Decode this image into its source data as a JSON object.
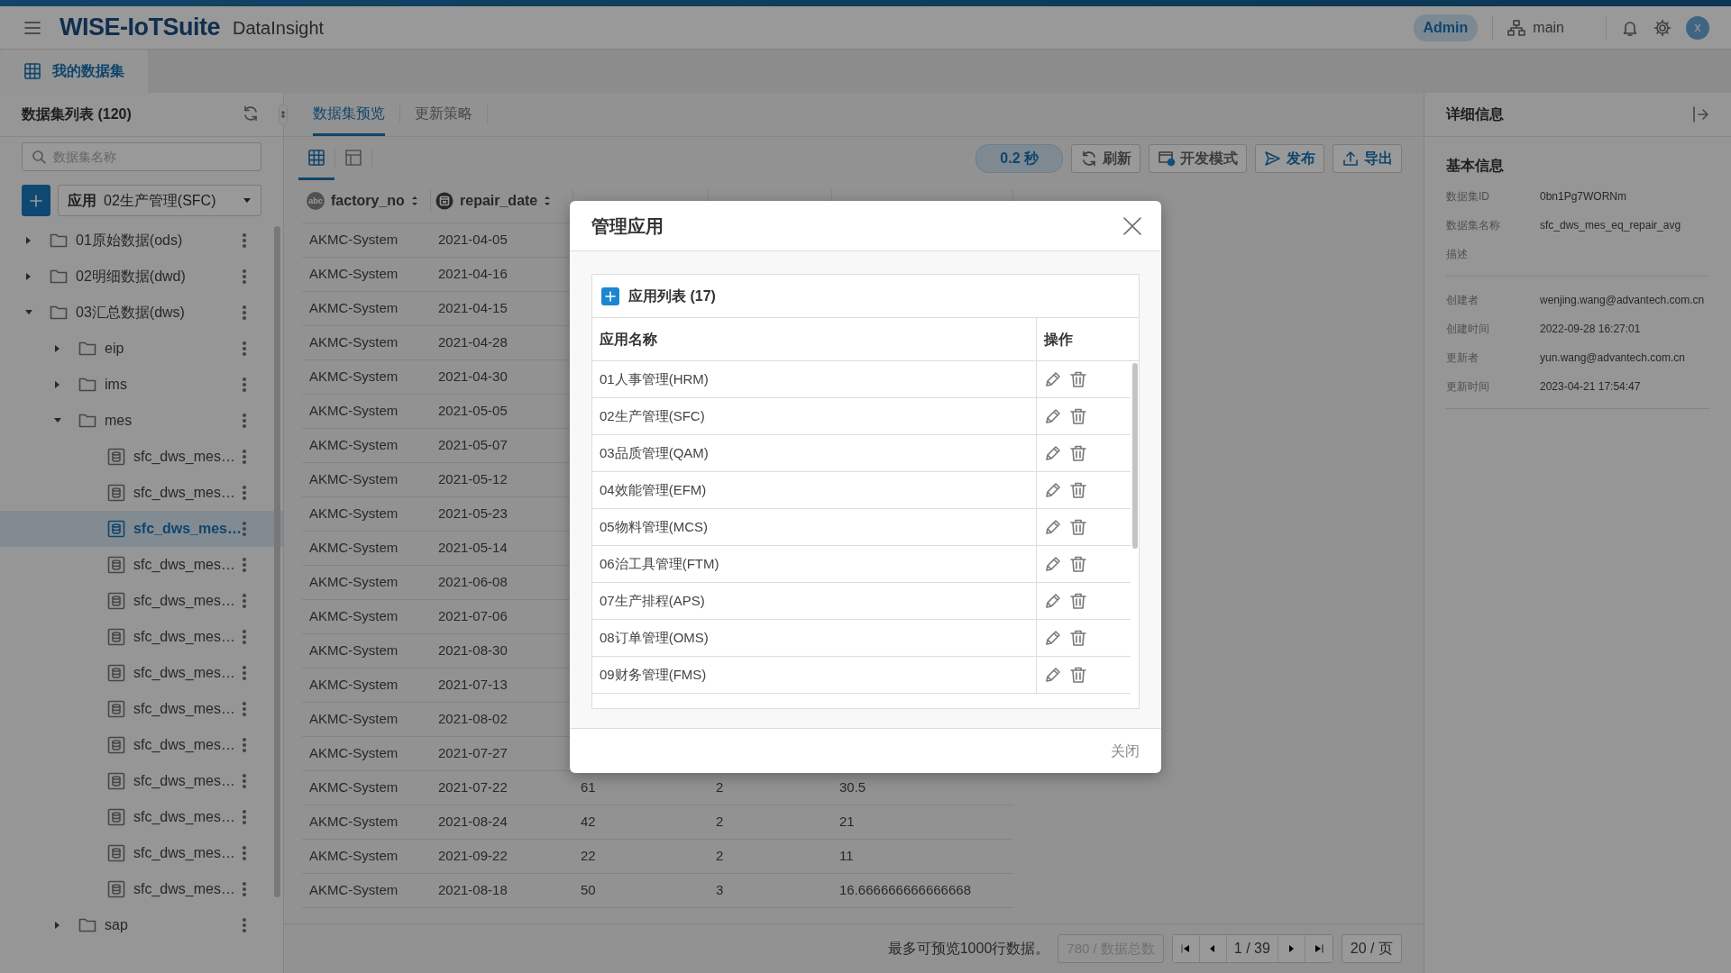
{
  "header": {
    "brand": "WISE-IoTSuite",
    "product": "DataInsight",
    "role": "Admin",
    "workspace": "main",
    "avatar": "x"
  },
  "page_tabs": [
    {
      "label": "我的数据集",
      "selected": true
    }
  ],
  "dataset_list": {
    "title": "数据集列表 (120)",
    "search_placeholder": "数据集名称",
    "app_label": "应用",
    "app_value": "02生产管理(SFC)",
    "tree": [
      {
        "label": "01原始数据(ods)",
        "kind": "folder",
        "expanded": false,
        "selected": false
      },
      {
        "label": "02明细数据(dwd)",
        "kind": "folder",
        "expanded": false,
        "selected": false
      },
      {
        "label": "03汇总数据(dws)",
        "kind": "folder",
        "expanded": true,
        "selected": false,
        "children": [
          {
            "label": "eip",
            "kind": "folder",
            "expanded": false,
            "selected": false
          },
          {
            "label": "ims",
            "kind": "folder",
            "expanded": false,
            "selected": false
          },
          {
            "label": "mes",
            "kind": "folder",
            "expanded": true,
            "selected": false,
            "children": [
              {
                "label": "sfc_dws_mes…",
                "kind": "dataset",
                "selected": false
              },
              {
                "label": "sfc_dws_mes…",
                "kind": "dataset",
                "selected": false
              },
              {
                "label": "sfc_dws_mes…",
                "kind": "dataset",
                "selected": true
              },
              {
                "label": "sfc_dws_mes…",
                "kind": "dataset",
                "selected": false
              },
              {
                "label": "sfc_dws_mes…",
                "kind": "dataset",
                "selected": false
              },
              {
                "label": "sfc_dws_mes…",
                "kind": "dataset",
                "selected": false
              },
              {
                "label": "sfc_dws_mes…",
                "kind": "dataset",
                "selected": false
              },
              {
                "label": "sfc_dws_mes…",
                "kind": "dataset",
                "selected": false
              },
              {
                "label": "sfc_dws_mes…",
                "kind": "dataset",
                "selected": false
              },
              {
                "label": "sfc_dws_mes…",
                "kind": "dataset",
                "selected": false
              },
              {
                "label": "sfc_dws_mes…",
                "kind": "dataset",
                "selected": false
              },
              {
                "label": "sfc_dws_mes…",
                "kind": "dataset",
                "selected": false
              },
              {
                "label": "sfc_dws_mes…",
                "kind": "dataset",
                "selected": false
              }
            ]
          },
          {
            "label": "sap",
            "kind": "folder",
            "expanded": false,
            "selected": false
          }
        ]
      }
    ]
  },
  "preview": {
    "tabs": [
      {
        "label": "数据集预览",
        "selected": true
      },
      {
        "label": "更新策略",
        "selected": false
      }
    ],
    "view_modes": [
      {
        "kind": "grid",
        "selected": true
      },
      {
        "kind": "layout",
        "selected": false
      }
    ],
    "timing": "0.2 秒",
    "actions": [
      {
        "label": "刷新",
        "kind": "refresh",
        "primary": false
      },
      {
        "label": "开发模式",
        "kind": "dev",
        "primary": false
      },
      {
        "label": "发布",
        "kind": "publish",
        "primary": true
      },
      {
        "label": "导出",
        "kind": "export",
        "primary": true
      }
    ],
    "columns": [
      {
        "name": "factory_no",
        "kind": "text",
        "badge": "abc"
      },
      {
        "name": "repair_date",
        "kind": "date"
      }
    ],
    "rows": [
      [
        "AKMC-System",
        "2021-04-05"
      ],
      [
        "AKMC-System",
        "2021-04-16"
      ],
      [
        "AKMC-System",
        "2021-04-15"
      ],
      [
        "AKMC-System",
        "2021-04-28"
      ],
      [
        "AKMC-System",
        "2021-04-30"
      ],
      [
        "AKMC-System",
        "2021-05-05"
      ],
      [
        "AKMC-System",
        "2021-05-07"
      ],
      [
        "AKMC-System",
        "2021-05-12"
      ],
      [
        "AKMC-System",
        "2021-05-23"
      ],
      [
        "AKMC-System",
        "2021-05-14"
      ],
      [
        "AKMC-System",
        "2021-06-08"
      ],
      [
        "AKMC-System",
        "2021-07-06"
      ],
      [
        "AKMC-System",
        "2021-08-30"
      ],
      [
        "AKMC-System",
        "2021-07-13"
      ],
      [
        "AKMC-System",
        "2021-08-02"
      ],
      [
        "AKMC-System",
        "2021-07-27"
      ],
      [
        "AKMC-System",
        "2021-07-22",
        "61",
        "2",
        "30.5"
      ],
      [
        "AKMC-System",
        "2021-08-24",
        "42",
        "2",
        "21"
      ],
      [
        "AKMC-System",
        "2021-09-22",
        "22",
        "2",
        "11"
      ],
      [
        "AKMC-System",
        "2021-08-18",
        "50",
        "3",
        "16.666666666666668"
      ]
    ],
    "footer": {
      "note": "最多可预览1000行数据。",
      "total": "780 / 数据总数",
      "page": "1 / 39",
      "page_size": "20 / 页"
    }
  },
  "details": {
    "title": "详细信息",
    "section": "基本信息",
    "groups": [
      [
        {
          "label": "数据集ID",
          "value": "0bn1Pg7WORNm"
        },
        {
          "label": "数据集名称",
          "value": "sfc_dws_mes_eq_repair_avg"
        },
        {
          "label": "描述"
        }
      ],
      [
        {
          "label": "创建者",
          "value": "wenjing.wang@advantech.com.cn"
        },
        {
          "label": "创建时间",
          "value": "2022-09-28 16:27:01"
        },
        {
          "label": "更新者",
          "value": "yun.wang@advantech.com.cn"
        },
        {
          "label": "更新时间",
          "value": "2023-04-21 17:54:47"
        }
      ]
    ]
  },
  "modal": {
    "title": "管理应用",
    "list_title": "应用列表 (17)",
    "columns": [
      "应用名称",
      "操作"
    ],
    "apps": [
      "01人事管理(HRM)",
      "02生产管理(SFC)",
      "03品质管理(QAM)",
      "04效能管理(EFM)",
      "05物料管理(MCS)",
      "06治工具管理(FTM)",
      "07生产排程(APS)",
      "08订单管理(OMS)",
      "09财务管理(FMS)"
    ],
    "close": "关闭"
  }
}
